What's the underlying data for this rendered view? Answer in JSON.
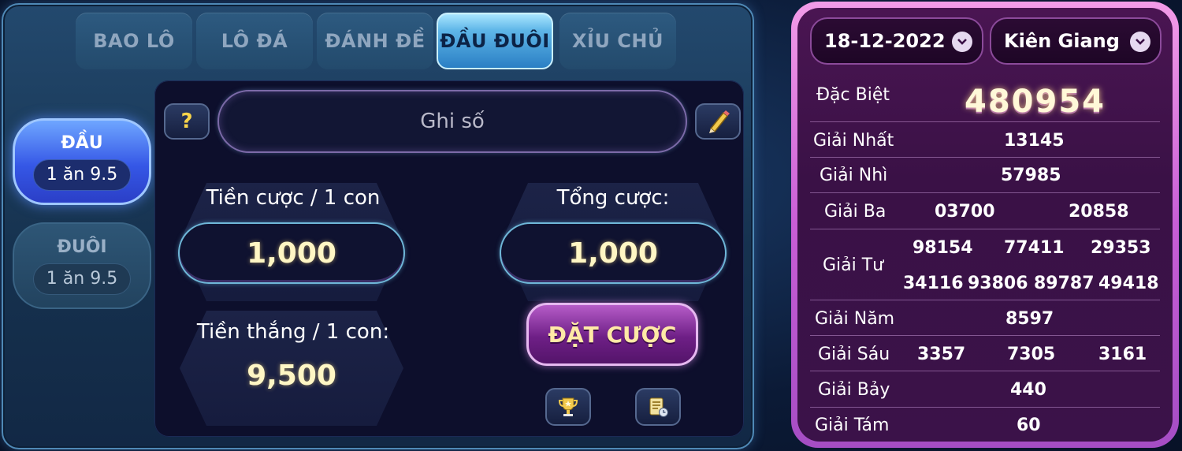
{
  "tabs": [
    {
      "label": "BAO LÔ",
      "active": false
    },
    {
      "label": "LÔ ĐÁ",
      "active": false
    },
    {
      "label": "ĐÁNH ĐỀ",
      "active": false
    },
    {
      "label": "ĐẦU ĐUÔI",
      "active": true
    },
    {
      "label": "XỈU CHỦ",
      "active": false
    }
  ],
  "side_options": [
    {
      "title": "ĐẦU",
      "odds": "1 ăn 9.5",
      "selected": true
    },
    {
      "title": "ĐUÔI",
      "odds": "1 ăn 9.5",
      "selected": false
    }
  ],
  "help_label": "?",
  "number_input": {
    "placeholder": "Ghi số",
    "value": ""
  },
  "bet_per_number": {
    "label": "Tiền cược / 1 con",
    "value": "1,000"
  },
  "total_bet": {
    "label": "Tổng cược:",
    "value": "1,000"
  },
  "win_per_number": {
    "label": "Tiền thắng / 1 con:",
    "value": "9,500"
  },
  "place_bet_label": "ĐẶT CƯỢC",
  "icons": {
    "edit": "pencil-icon",
    "trophy": "trophy-icon",
    "history": "bet-history-icon",
    "dropdown": "chevron-down-icon"
  },
  "results": {
    "date": "18-12-2022",
    "province": "Kiên Giang",
    "prizes": [
      {
        "label": "Đặc Biệt",
        "numbers": [
          "480954"
        ]
      },
      {
        "label": "Giải Nhất",
        "numbers": [
          "13145"
        ]
      },
      {
        "label": "Giải Nhì",
        "numbers": [
          "57985"
        ]
      },
      {
        "label": "Giải Ba",
        "numbers": [
          "03700",
          "20858"
        ]
      },
      {
        "label": "Giải Tư",
        "numbers": [
          "98154",
          "77411",
          "29353",
          "34116",
          "93806",
          "89787",
          "49418"
        ]
      },
      {
        "label": "Giải Năm",
        "numbers": [
          "8597"
        ]
      },
      {
        "label": "Giải Sáu",
        "numbers": [
          "3357",
          "7305",
          "3161"
        ]
      },
      {
        "label": "Giải Bảy",
        "numbers": [
          "440"
        ]
      },
      {
        "label": "Giải Tám",
        "numbers": [
          "60"
        ]
      }
    ]
  },
  "colors": {
    "active_tab": "#5fb6e8",
    "panel_border": "#4f89b6",
    "results_frame": "#c85ed6",
    "bet_button": "#6e1f86",
    "value_text": "#fff6c4"
  }
}
